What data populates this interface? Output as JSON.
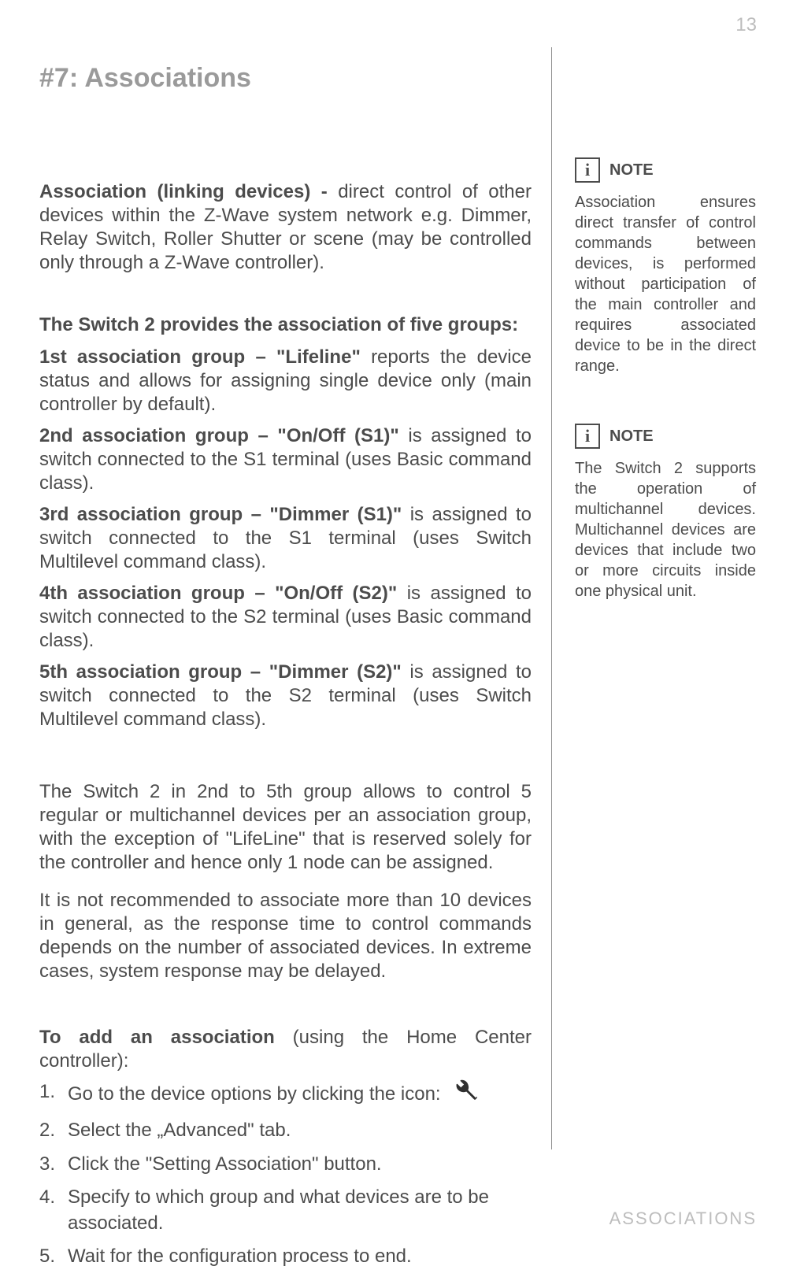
{
  "page_number": "13",
  "section_title": "#7: Associations",
  "intro_bold": "Association (linking devices) - ",
  "intro_rest": "direct control of other devices within the Z-Wave system network e.g. Dimmer, Relay Switch, Roller Shutter or scene (may be controlled only through a Z-Wave controller).",
  "groups_heading": "The Switch 2 provides the association of five groups:",
  "groups": [
    {
      "bold": "1st association group – \"Lifeline\" ",
      "rest": "reports the device status and allows for assigning single device only (main controller by default)."
    },
    {
      "bold": "2nd association group –  \"On/Off (S1)\" ",
      "rest": "is assigned to switch connected to the S1 terminal (uses Basic command class)."
    },
    {
      "bold": "3rd association group – \"Dimmer (S1)\" ",
      "rest": "is assigned to switch connected to the S1 terminal (uses Switch Multilevel command class)."
    },
    {
      "bold": "4th association group – \"On/Off (S2)\" ",
      "rest": "is assigned to switch connected to the S2 terminal (uses Basic command class)."
    },
    {
      "bold": "5th association group – \"Dimmer (S2)\" ",
      "rest": "is assigned to switch connected to the S2 terminal (uses Switch Multilevel command class)."
    }
  ],
  "details_p1": "The Switch 2 in 2nd to 5th group allows to control 5 regular or multichannel devices per an association group, with the exception of \"LifeLine\" that is reserved solely for the controller and hence only 1 node can  be assigned.",
  "details_p2": "It is not recommended to associate more than 10 devices in general, as the response time to control commands depends on the number of associated devices. In extreme cases, system response may be delayed.",
  "add_assoc_bold": "To add an association ",
  "add_assoc_rest": "(using the Home Center controller):",
  "steps": [
    "Go to the device options by clicking the icon:",
    "Select the „Advanced\" tab.",
    "Click the \"Setting Association\" button.",
    "Specify to which group and what devices are to be associated.",
    "Wait for the configuration process to end."
  ],
  "notes": [
    {
      "label": "NOTE",
      "icon": "i",
      "body": "Association ensures direct transfer of control commands between devices, is performed without participation of the main controller and requires associated device to be in the direct range."
    },
    {
      "label": "NOTE",
      "icon": "i",
      "body": "The Switch 2 supports the operation of multichannel devices. Multichannel devices are devices that include two or more circuits inside one physical unit."
    }
  ],
  "footer_label": "ASSOCIATIONS"
}
